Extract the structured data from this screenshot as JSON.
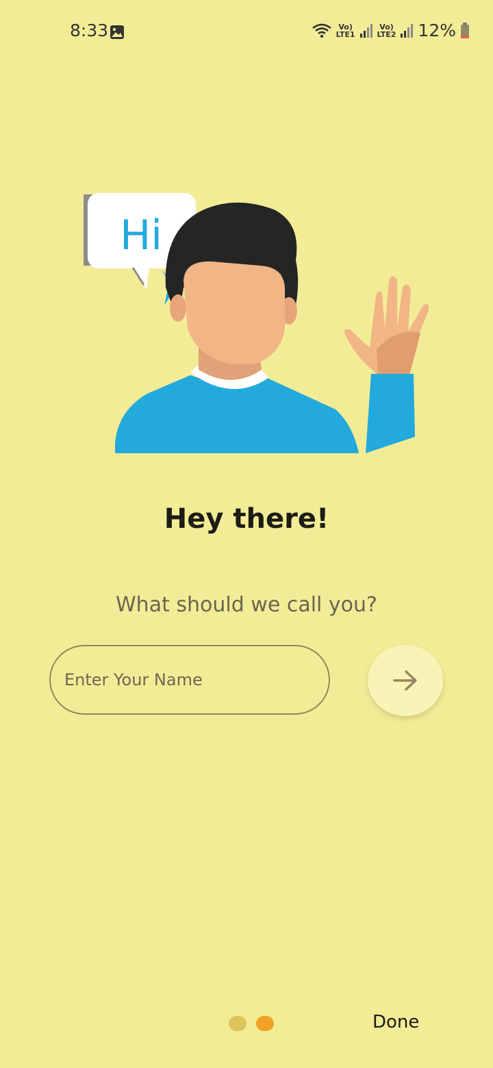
{
  "status_bar": {
    "time": "8:33",
    "battery_percent": "12%",
    "lte1": "Vo) LTE1",
    "lte2": "Vo) LTE2",
    "icons": [
      "gallery-icon",
      "wifi-icon",
      "signal-icon",
      "signal-icon",
      "battery-icon"
    ]
  },
  "illustration": {
    "bubble_text": "Hi"
  },
  "greeting": "Hey there!",
  "prompt": "What should we call you?",
  "name_input": {
    "placeholder": "Enter Your Name",
    "value": ""
  },
  "next_button": {
    "icon": "arrow-right-icon"
  },
  "pager": {
    "total_pages": 2,
    "current_page": 2
  },
  "done_label": "Done",
  "colors": {
    "background": "#F3EC97",
    "dot_inactive": "#DEC45A",
    "dot_active": "#F2A227",
    "shirt": "#23A9DC",
    "hair": "#252525",
    "skin": "#F2B586"
  }
}
